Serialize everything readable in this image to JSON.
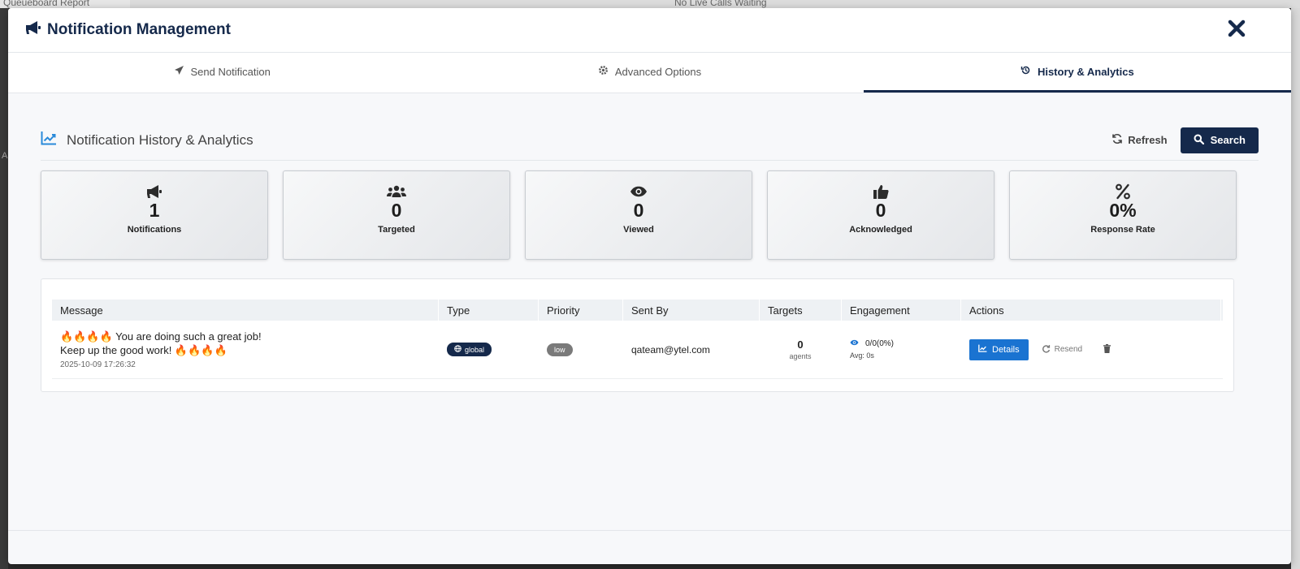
{
  "background": {
    "top_left_text": "Queueboard Report",
    "top_center_text": "No Live Calls Waiting",
    "side_letter": "A"
  },
  "modal": {
    "title": "Notification Management",
    "title_icon": "megaphone-icon",
    "close_icon": "close-icon"
  },
  "tabs": [
    {
      "label": "Send Notification",
      "icon": "paper-plane-icon",
      "active": false
    },
    {
      "label": "Advanced Options",
      "icon": "gear-icon",
      "active": false
    },
    {
      "label": "History & Analytics",
      "icon": "history-icon",
      "active": true
    }
  ],
  "section": {
    "title": "Notification History & Analytics",
    "icon": "chart-line-icon",
    "refresh_label": "Refresh",
    "search_label": "Search"
  },
  "stats": [
    {
      "value": "1",
      "label": "Notifications",
      "icon": "megaphone-icon"
    },
    {
      "value": "0",
      "label": "Targeted",
      "icon": "users-icon"
    },
    {
      "value": "0",
      "label": "Viewed",
      "icon": "eye-icon"
    },
    {
      "value": "0",
      "label": "Acknowledged",
      "icon": "thumbs-up-icon"
    },
    {
      "value": "0%",
      "label": "Response Rate",
      "icon": "percent-icon"
    }
  ],
  "table": {
    "headers": [
      "Message",
      "Type",
      "Priority",
      "Sent By",
      "Targets",
      "Engagement",
      "Actions"
    ],
    "rows": [
      {
        "message": "🔥🔥🔥🔥 You are doing such a great job! Keep up the good work! 🔥🔥🔥🔥",
        "date": "2025-10-09 17:26:32",
        "type": "global",
        "priority": "low",
        "sent_by": "qateam@ytel.com",
        "targets": "0",
        "targets_sub": "agents",
        "engagement": "0/0(0%)",
        "avg": "Avg: 0s",
        "details_label": "Details",
        "resend_label": "Resend"
      }
    ]
  },
  "colors": {
    "brand_navy": "#15294b",
    "details_blue": "#1a73d1",
    "accent_icon": "#2a8ad9"
  }
}
